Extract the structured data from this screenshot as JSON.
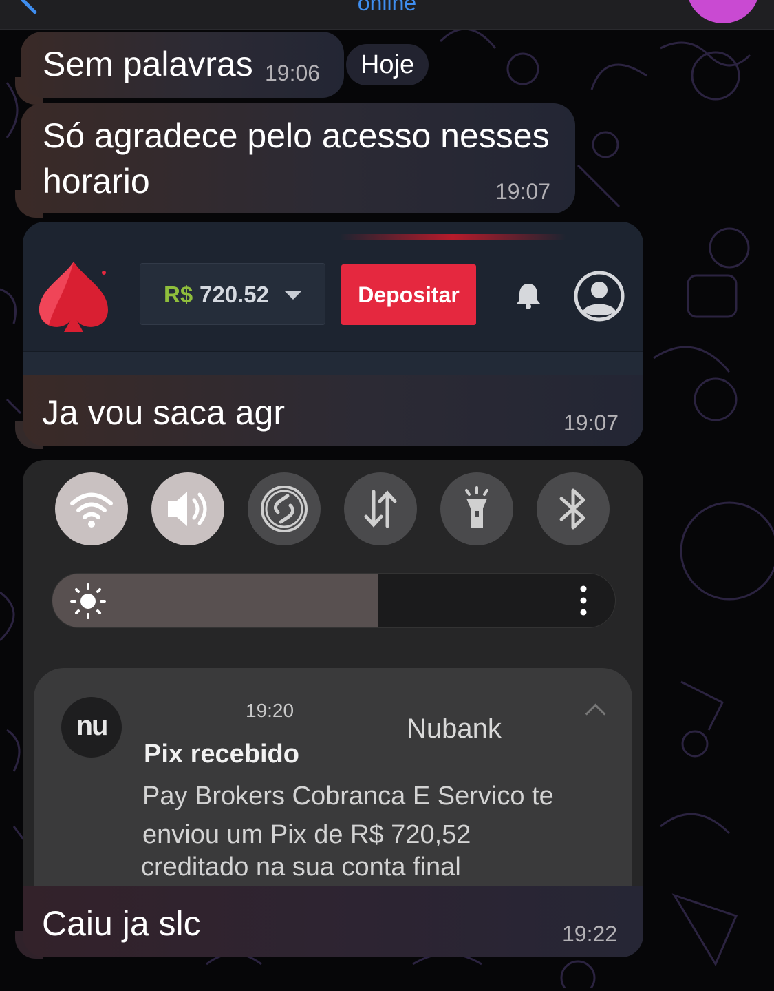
{
  "header": {
    "status": "online"
  },
  "date_pill": "Hoje",
  "messages": [
    {
      "text": "Sem palavras",
      "time": "19:06"
    },
    {
      "line1": "Só agradece pelo acesso nesses",
      "line2": "horario",
      "time": "19:07"
    },
    {
      "caption": "Ja vou saca agr",
      "time": "19:07"
    },
    {
      "caption": "Caiu ja slc",
      "time": "19:22"
    }
  ],
  "casino": {
    "currency": "R$",
    "balance": "720.52",
    "deposit_label": "Depositar",
    "accent": "#e5283f"
  },
  "phone": {
    "quick_settings": [
      "wifi-icon",
      "volume-icon",
      "sync-icon",
      "data-transfer-icon",
      "flashlight-icon",
      "bluetooth-icon"
    ],
    "brightness_level": 0.58,
    "notification": {
      "logo": "nu",
      "time": "19:20",
      "app": "Nubank",
      "title": "Pix recebido",
      "body": "Pay Brokers Cobranca E Servico te enviou um Pix de R$ 720,52",
      "extra": "creditado na sua conta final"
    }
  },
  "colors": {
    "link_blue": "#3f8ef0",
    "avatar": "#c94ad2",
    "casino_green": "#8fbe3c"
  }
}
